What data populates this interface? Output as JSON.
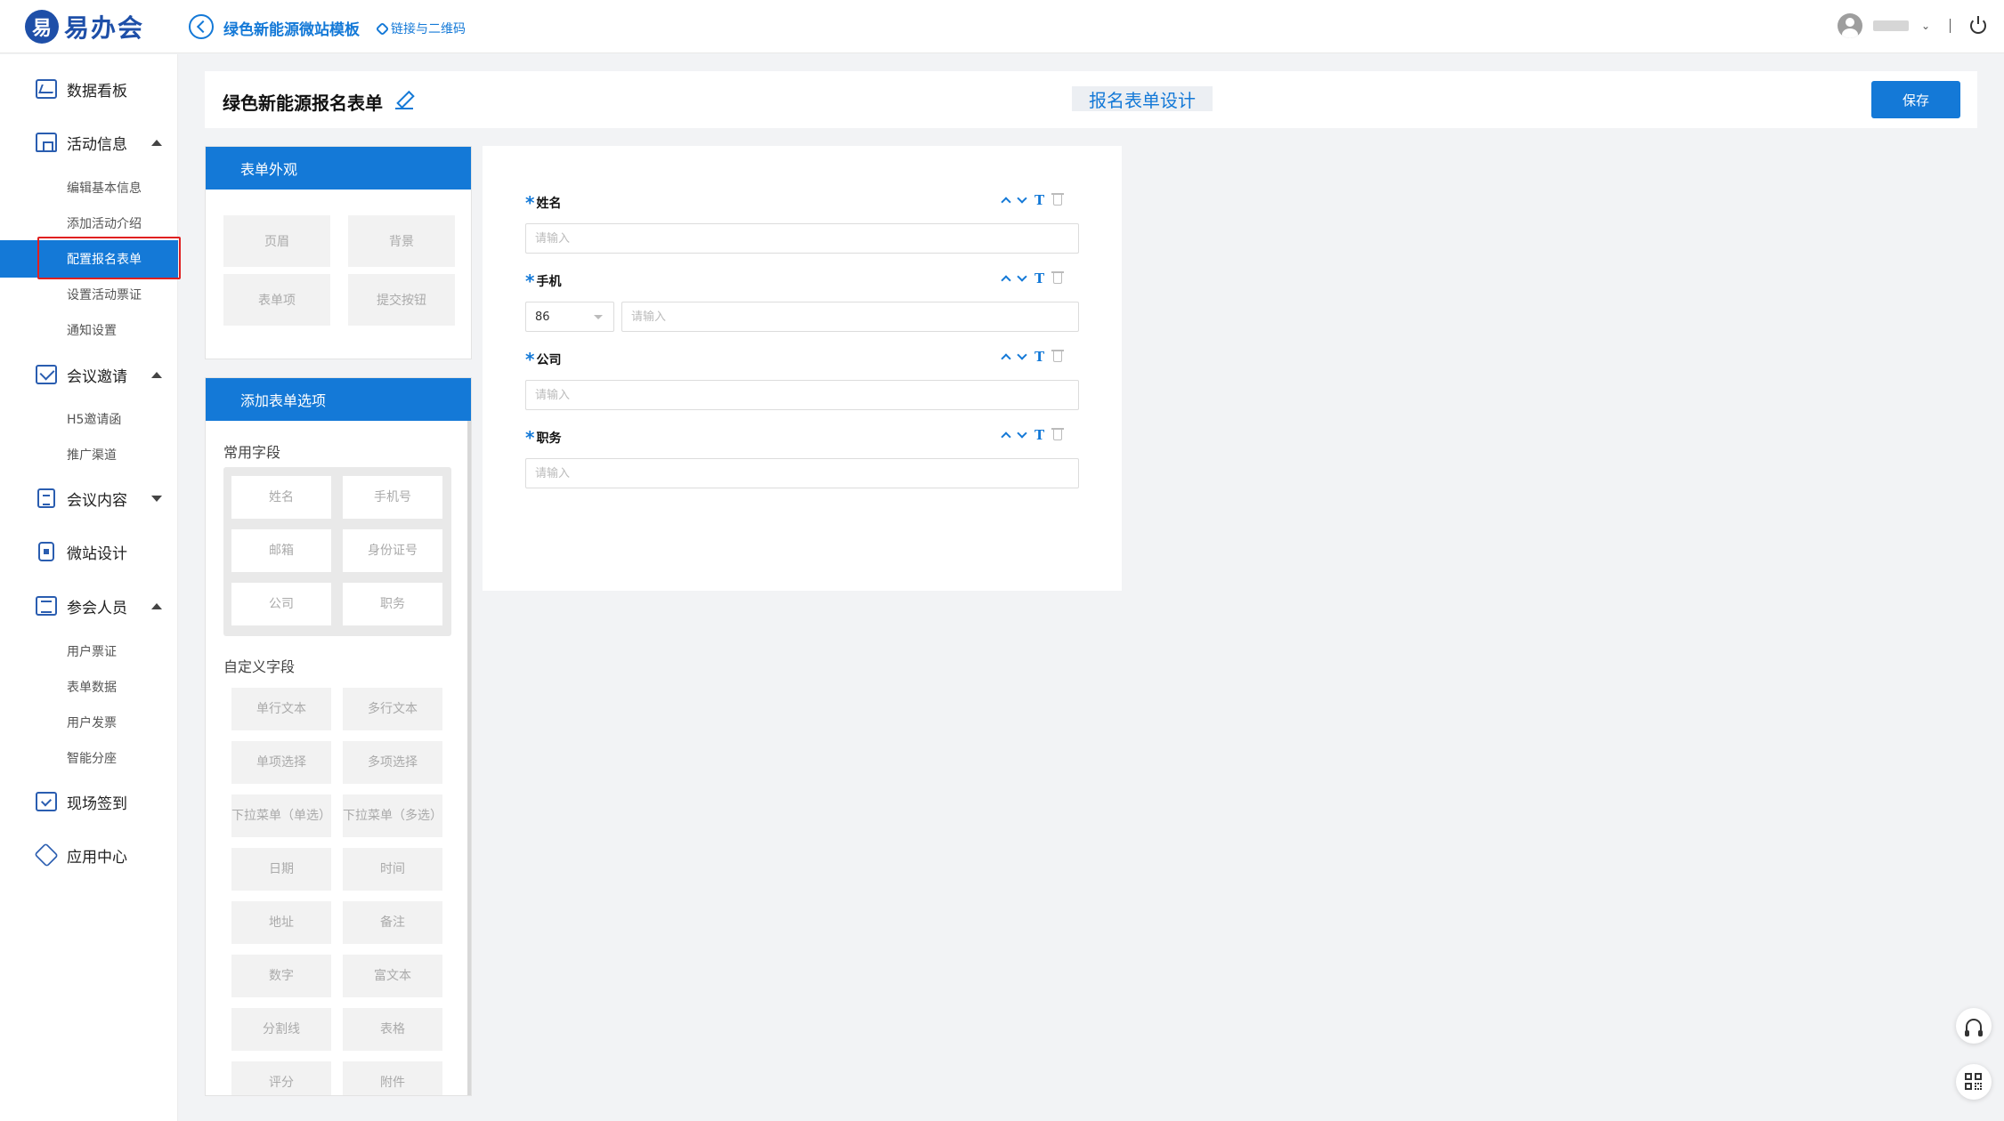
{
  "topbar": {
    "logo_mark": "易",
    "logo_text": "易办会",
    "site_title": "绿色新能源微站模板",
    "qr_link": "链接与二维码"
  },
  "sidebar": {
    "groups": [
      {
        "label": "数据看板",
        "icon": "chart-icon"
      },
      {
        "label": "活动信息",
        "icon": "home-icon",
        "expanded": true,
        "children": [
          "编辑基本信息",
          "添加活动介绍",
          "配置报名表单",
          "设置活动票证",
          "通知设置"
        ]
      },
      {
        "label": "会议邀请",
        "icon": "mail-icon",
        "expanded": true,
        "children": [
          "H5邀请函",
          "推广渠道"
        ]
      },
      {
        "label": "会议内容",
        "icon": "clipboard-icon",
        "expanded": false
      },
      {
        "label": "微站设计",
        "icon": "phone-icon"
      },
      {
        "label": "参会人员",
        "icon": "list-icon",
        "expanded": true,
        "children": [
          "用户票证",
          "表单数据",
          "用户发票",
          "智能分座"
        ]
      },
      {
        "label": "现场签到",
        "icon": "calendar-check-icon"
      },
      {
        "label": "应用中心",
        "icon": "cube-icon"
      }
    ],
    "active_item": "配置报名表单"
  },
  "header": {
    "title": "绿色新能源报名表单",
    "design_tab": "报名表单设计",
    "save_label": "保存"
  },
  "appearance_panel": {
    "title": "表单外观",
    "buttons": [
      "页眉",
      "背景",
      "表单项",
      "提交按钮"
    ]
  },
  "options_panel": {
    "title": "添加表单选项",
    "common_label": "常用字段",
    "common_fields": [
      "姓名",
      "手机号",
      "邮箱",
      "身份证号",
      "公司",
      "职务"
    ],
    "custom_label": "自定义字段",
    "custom_fields": [
      "单行文本",
      "多行文本",
      "单项选择",
      "多项选择",
      "下拉菜单（单选）",
      "下拉菜单（多选）",
      "日期",
      "时间",
      "地址",
      "备注",
      "数字",
      "富文本",
      "分割线",
      "表格",
      "评分",
      "附件"
    ]
  },
  "preview": {
    "fields": [
      {
        "label": "姓名",
        "required": true,
        "placeholder": "请输入"
      },
      {
        "label": "手机",
        "required": true,
        "placeholder": "请输入",
        "country_code": "86"
      },
      {
        "label": "公司",
        "required": true,
        "placeholder": "请输入"
      },
      {
        "label": "职务",
        "required": true,
        "placeholder": "请输入"
      }
    ],
    "required_mark": "*",
    "tool_t": "T"
  },
  "colors": {
    "primary": "#1479d7",
    "logo": "#1e4fa8",
    "highlight_border": "#e02020"
  }
}
